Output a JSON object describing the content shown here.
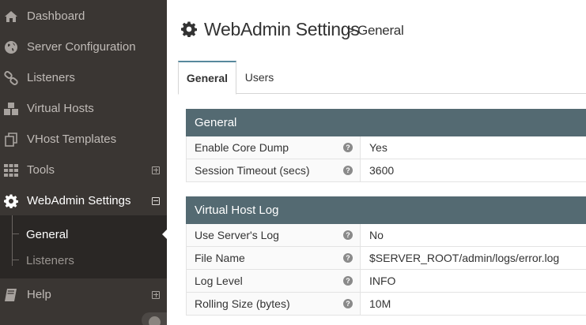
{
  "sidebar": {
    "items": [
      {
        "label": "Dashboard",
        "icon": "home-icon"
      },
      {
        "label": "Server Configuration",
        "icon": "globe-icon"
      },
      {
        "label": "Listeners",
        "icon": "link-icon"
      },
      {
        "label": "Virtual Hosts",
        "icon": "cubes-icon"
      },
      {
        "label": "VHost Templates",
        "icon": "copy-icon"
      },
      {
        "label": "Tools",
        "icon": "grid-icon"
      },
      {
        "label": "WebAdmin Settings",
        "icon": "gear-icon"
      },
      {
        "label": "Help",
        "icon": "book-icon"
      }
    ],
    "submenu": [
      {
        "label": "General"
      },
      {
        "label": "Listeners"
      }
    ]
  },
  "header": {
    "title": "WebAdmin Settings",
    "subtitle": "> General"
  },
  "tabs": [
    {
      "label": "General"
    },
    {
      "label": "Users"
    }
  ],
  "general": {
    "title": "General",
    "rows": [
      {
        "label": "Enable Core Dump",
        "value": "Yes"
      },
      {
        "label": "Session Timeout (secs)",
        "value": "3600"
      }
    ]
  },
  "vhost_log": {
    "title": "Virtual Host Log",
    "rows": [
      {
        "label": "Use Server's Log",
        "value": "No"
      },
      {
        "label": "File Name",
        "value": "$SERVER_ROOT/admin/logs/error.log"
      },
      {
        "label": "Log Level",
        "value": "INFO"
      },
      {
        "label": "Rolling Size (bytes)",
        "value": "10M"
      }
    ]
  },
  "help_glyph": "?",
  "colors": {
    "sidebar_bg": "#3a3633",
    "panel_header_bg": "#546a72",
    "active_tab_accent": "#57889c"
  }
}
